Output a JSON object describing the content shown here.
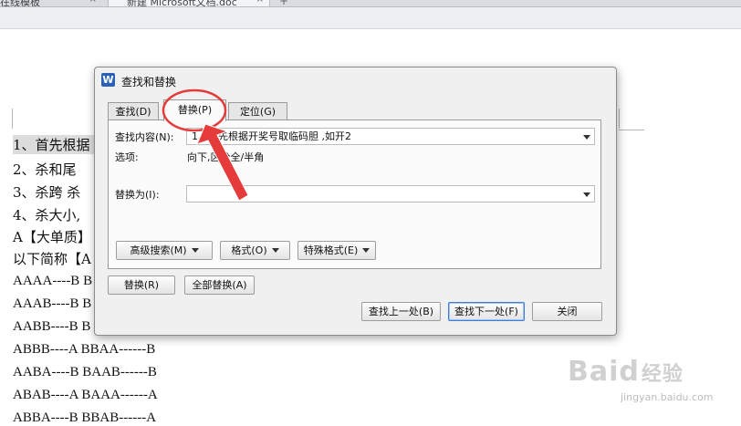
{
  "tab_strip": {
    "tab1_title": "在线模板",
    "tab2_title": "新建 Microsoft文档.doc",
    "close_glyph": "×",
    "new_tab_glyph": "+"
  },
  "document": {
    "lines": [
      "1、首先根据",
      "2、杀和尾 ",
      "3、杀跨 杀",
      "4、杀大小,",
      "A【大单质】",
      "以下简称【A",
      "AAAA----B B",
      "AAAB----B B",
      "AABB----B B",
      "ABBB----A BBAA------B",
      "AABA----B BAAB------B",
      "ABAB----A BAAA------A",
      "ABBA----B BBAB------A"
    ]
  },
  "dialog": {
    "logo_glyph": "W",
    "title": "查找和替换",
    "tabs": {
      "find": "查找(D)",
      "replace": "替换(P)",
      "goto": "定位(G)"
    },
    "find_label": "查找内容(N):",
    "find_value": "1、首先根据开奖号取临码胆 ,如开2",
    "options_label": "选项:",
    "options_value": "向下,区分全/半角",
    "replace_label": "替换为(I):",
    "replace_value": "",
    "buttons": {
      "advanced_search": "高级搜索(M)",
      "format": "格式(O)",
      "special_format": "特殊格式(E)",
      "replace": "替换(R)",
      "replace_all": "全部替换(A)",
      "find_previous": "查找上一处(B)",
      "find_next": "查找下一处(F)",
      "close": "关闭"
    }
  },
  "annotation": {
    "color": "#e53b3b"
  },
  "watermark": {
    "brand": "Baid",
    "brand_cn": "经验",
    "url": "jingyan.baidu.com"
  }
}
